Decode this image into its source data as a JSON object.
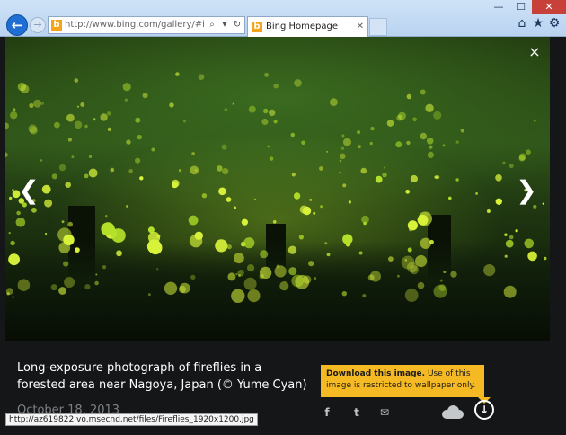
{
  "browser": {
    "address_url": "http://www.bing.com/gallery/#images/Fire",
    "tab_title": "Bing Homepage Gallery",
    "tab_close_glyph": "✕",
    "window_controls": {
      "minimize": "—",
      "maximize": "☐",
      "close": "✕"
    },
    "icons": [
      "back-icon",
      "forward-icon",
      "search-icon",
      "refresh-icon",
      "home-icon",
      "star-icon",
      "gear-icon"
    ],
    "status_url": "http://az619822.vo.msecnd.net/files/Fireflies_1920x1200.jpg"
  },
  "gallery": {
    "caption": "Long-exposure photograph of fireflies in a forested area near Nagoya, Japan (© Yume Cyan)",
    "date": "October 18, 2013",
    "close_glyph": "×",
    "prev_glyph": "❮",
    "next_glyph": "❯",
    "share_icons": {
      "facebook": "f",
      "twitter": "t",
      "email": "✉",
      "download": "↓"
    },
    "tooltip": {
      "title": "Download this image.",
      "text": " Use of this image is restricted to wallpaper only."
    }
  },
  "colors": {
    "accent_blue": "#1e6ed3",
    "tooltip_yellow": "#f4b923",
    "close_red": "#c7403a",
    "page_dark": "#151617"
  }
}
